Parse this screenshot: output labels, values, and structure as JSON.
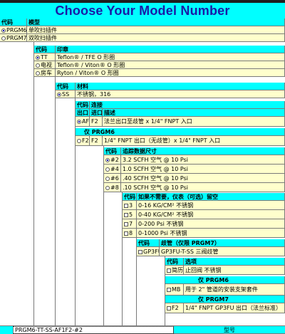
{
  "window_title_strip": "",
  "title": "Choose Your Model Number",
  "model": {
    "h_code": "代码",
    "h_desc": "模型",
    "rows": [
      {
        "code": "PRGM6",
        "desc": "单吹扫插件",
        "selected": true
      },
      {
        "code": "PRGM7",
        "desc": "双吹扫插件",
        "selected": false
      }
    ]
  },
  "seal": {
    "h_code": "代码",
    "h_desc": "印章",
    "rows": [
      {
        "code": "TT",
        "desc": "Teflon® / TFE O 形圈",
        "selected": true
      },
      {
        "code": "电视",
        "desc": "Teflon® / Viton® O 形圈",
        "selected": false
      },
      {
        "code": "房车",
        "desc": "Ryton / Viton® O 形圈",
        "selected": false
      }
    ]
  },
  "material": {
    "h_code": "代码",
    "h_desc": "材料",
    "rows": [
      {
        "code": "SS",
        "desc": "不锈钢，316",
        "selected": true
      }
    ]
  },
  "connection": {
    "h_code": "代码",
    "h_conn": "连接",
    "h_out": "出口",
    "h_in": "进口",
    "h_desc": "描述",
    "rows": [
      {
        "code": "AF1",
        "inlet": "F2",
        "desc": "法兰出口至歧管 x 1/4\" FNPT 入口",
        "selected": true
      }
    ],
    "only_label": "仅 PRGM6",
    "only_rows": [
      {
        "inlet": "F2",
        "in2": "F2",
        "desc": "1/4\" FNPT 出口（无歧管）x 1/4\" FNPT 入口",
        "selected": false
      }
    ]
  },
  "flow": {
    "h_code": "代码",
    "h_desc": "追踪数据尺寸",
    "rows": [
      {
        "code": "#2",
        "desc": "3.2 SCFH 空气 @ 10 Psi",
        "selected": true
      },
      {
        "code": "#4",
        "desc": "1.0 SCFH 空气 @ 10 Psi",
        "selected": false
      },
      {
        "code": "#6",
        "desc": ".40 SCFH 空气 @ 10 Psi",
        "selected": false
      },
      {
        "code": "#8",
        "desc": ".10 SCFH 空气 @ 10 Psi",
        "selected": false
      }
    ]
  },
  "gauge": {
    "h_code": "代码",
    "h_desc": "如果不需要，仪表（可选）留空",
    "rows": [
      {
        "code": "3",
        "desc": "0-16 KG/CM² 不锈钢"
      },
      {
        "code": "5",
        "desc": "0-40 KG/CM² 不锈钢"
      },
      {
        "code": "7",
        "desc": "0-200 Psi 不锈钢"
      },
      {
        "code": "8",
        "desc": "0-1000 Psi 不锈钢"
      }
    ]
  },
  "valve": {
    "h_code": "代码",
    "h_desc": "歧管（仅限 PRGM7）",
    "rows": [
      {
        "code": "GP3FU",
        "desc": "GP3FU-T-SS 三阀歧管"
      }
    ]
  },
  "options": {
    "h_code": "代码",
    "h_desc": "选项",
    "rows": [
      {
        "code": "简历",
        "desc": "止回阀 不锈钢"
      }
    ],
    "prgm6_label": "仅 PRGM6",
    "prgm6_rows": [
      {
        "code": "MB",
        "desc": "用于 2\" 管道的安装支架套件"
      }
    ],
    "prgm7_label": "仅 PRGM7",
    "prgm7_rows": [
      {
        "code": "F2",
        "desc": "1/4\" FNPT GP3FU 出口（法兰标准）"
      }
    ]
  },
  "result": {
    "model_number": "PRGM6-TT-SS-AF1F2-#2",
    "label": "型号"
  }
}
